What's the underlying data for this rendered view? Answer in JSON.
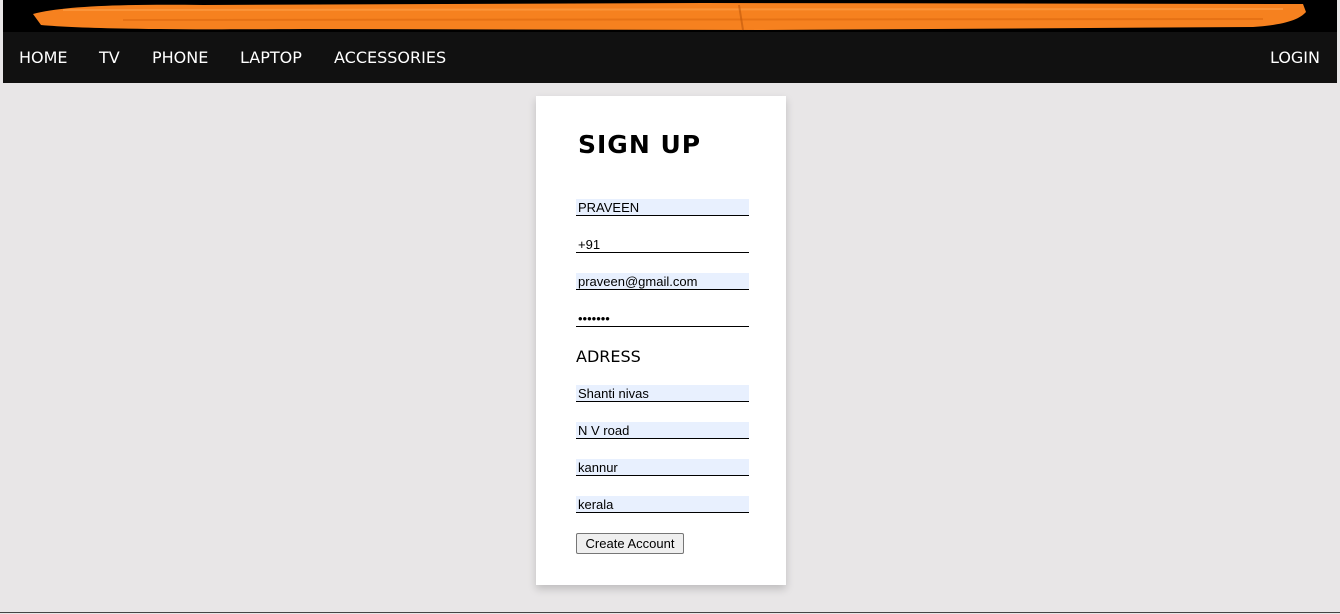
{
  "nav": {
    "items": [
      {
        "label": "HOME"
      },
      {
        "label": "TV"
      },
      {
        "label": "PHONE"
      },
      {
        "label": "LAPTOP"
      },
      {
        "label": "ACCESSORIES"
      }
    ],
    "login": "LOGIN"
  },
  "signup": {
    "title": "SIGN UP",
    "name_value": "PRAVEEN",
    "phone_value": "+91",
    "email_value": "praveen@gmail.com",
    "password_value": "1234567",
    "address_heading": "ADRESS",
    "address_line1_value": "Shanti nivas",
    "address_line2_value": "N V road",
    "city_value": "kannur",
    "state_value": "kerala",
    "submit_label": "Create Account"
  },
  "colors": {
    "banner_accent": "#f6811f",
    "navbar_bg": "#111111",
    "page_bg": "#e8e6e7",
    "autofill_bg": "#e8f0fe"
  }
}
